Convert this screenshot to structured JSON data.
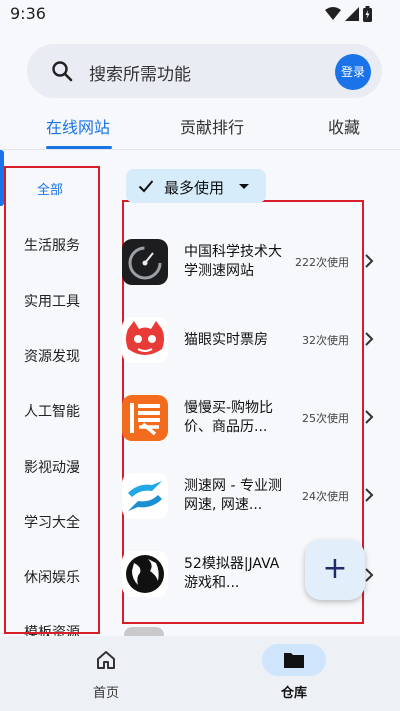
{
  "status_bar": {
    "time": "9:36"
  },
  "search": {
    "placeholder": "搜索所需功能",
    "login_label": "登录"
  },
  "tabs": [
    {
      "label": "在线网站",
      "active": true
    },
    {
      "label": "贡献排行",
      "active": false
    },
    {
      "label": "收藏",
      "active": false
    }
  ],
  "sidebar": {
    "items": [
      {
        "label": "全部",
        "active": true
      },
      {
        "label": "生活服务"
      },
      {
        "label": "实用工具"
      },
      {
        "label": "资源发现"
      },
      {
        "label": "人工智能"
      },
      {
        "label": "影视动漫"
      },
      {
        "label": "学习大全"
      },
      {
        "label": "休闲娱乐"
      },
      {
        "label": "模板资源"
      }
    ]
  },
  "filter": {
    "label": "最多使用"
  },
  "sites": [
    {
      "title": "中国科学技术大学测速网站",
      "usage": "222次使用",
      "icon": "speedometer-icon"
    },
    {
      "title": "猫眼实时票房",
      "usage": "32次使用",
      "icon": "cat-eye-icon"
    },
    {
      "title": "慢慢买-购物比价、商品历...",
      "usage": "25次使用",
      "icon": "manmanmai-icon"
    },
    {
      "title": "测速网 - 专业测网速, 网速...",
      "usage": "24次使用",
      "icon": "speedtest-icon"
    },
    {
      "title": "52模拟器|JAVA游戏和...",
      "usage": "",
      "icon": "globe-icon"
    }
  ],
  "fab": {
    "label": "+"
  },
  "bottom_nav": [
    {
      "label": "首页",
      "active": false,
      "icon": "home-icon"
    },
    {
      "label": "仓库",
      "active": true,
      "icon": "folder-icon"
    }
  ],
  "colors": {
    "accent": "#1a73e8",
    "highlight_box": "#d81d2a",
    "chip_bg": "#d6ecfb",
    "maoyan_red": "#e83a36",
    "manmanmai_orange": "#f36b1c"
  }
}
